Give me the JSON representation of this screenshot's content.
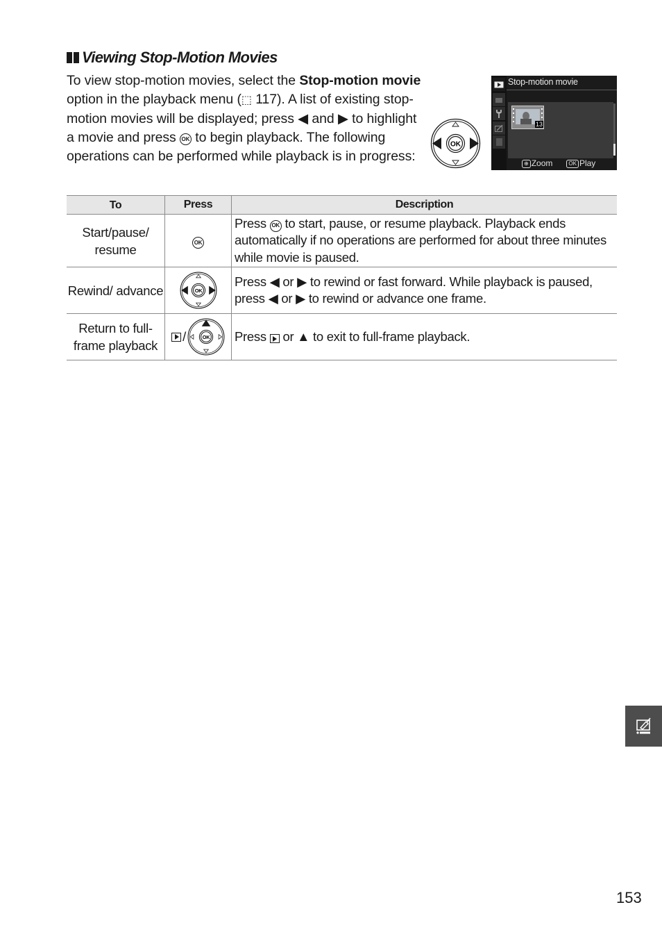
{
  "section": {
    "heading": "Viewing Stop-Motion Movies",
    "intro": {
      "p1": "To view stop-motion movies, select the ",
      "bold1": "Stop-motion movie",
      "p2": " option in the playback menu (",
      "book_symbol": "⬚",
      "page_ref": "117",
      "p3": ").  A list of existing stop-motion movies will be displayed; press ",
      "left_arrow": "◀",
      "p4": " and ",
      "right_arrow": "▶",
      "p5": " to highlight a movie and press ",
      "ok": "OK",
      "p6": " to begin playback.  The following operations can be performed while playback is in progress:"
    }
  },
  "camera_screen": {
    "title": "Stop-motion movie",
    "thumbnail_count": "13",
    "footer": {
      "zoom_badge": "⊕",
      "zoom_label": "Zoom",
      "play_badge": "OK",
      "play_label": "Play"
    },
    "menu_tabs": [
      "playback-icon",
      "camera-icon",
      "wrench-icon",
      "retouch-icon",
      "recent-settings-icon"
    ]
  },
  "table": {
    "headers": {
      "to": "To",
      "press": "Press",
      "description": "Description"
    },
    "rows": [
      {
        "to": "Start/pause/ resume",
        "press": "OK",
        "description": {
          "a": "Press ",
          "ok": "OK",
          "b": " to start, pause, or resume playback.  Playback ends automatically if no operations are performed for about three minutes while movie is paused."
        }
      },
      {
        "to": "Rewind/ advance",
        "press": "multi-selector-left-right",
        "description": {
          "a": "Press ",
          "l1": "◀",
          "b": " or ",
          "r1": "▶",
          "c": "  to rewind or fast forward. While playback is paused, press ",
          "l2": "◀",
          "d": " or ",
          "r2": "▶",
          "e": " to rewind or advance one frame."
        }
      },
      {
        "to": "Return to full-frame playback",
        "press_sep": "/",
        "description": {
          "a": "Press ",
          "b": " or ",
          "up": "▲",
          "c": " to exit to full-frame playback."
        }
      }
    ]
  },
  "page_number": "153"
}
